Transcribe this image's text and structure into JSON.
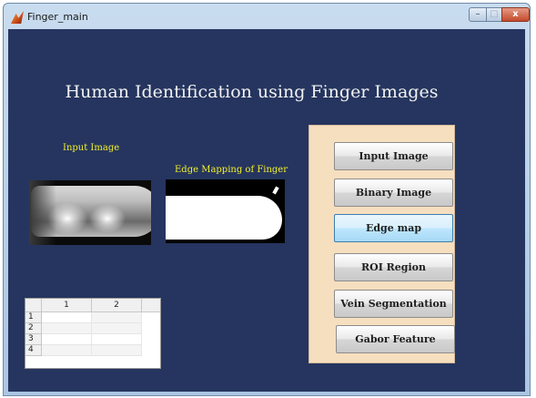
{
  "window": {
    "title": "Finger_main",
    "controls": {
      "minimize": "–",
      "maximize": "□",
      "close": "x"
    }
  },
  "main": {
    "heading": "Human Identification using Finger Images",
    "input_image_label": "Input Image",
    "edge_mapping_label": "Edge Mapping of Finger"
  },
  "table": {
    "columns": [
      "1",
      "2"
    ],
    "rows": [
      "1",
      "2",
      "3",
      "4"
    ]
  },
  "actions": [
    {
      "label": "Input Image",
      "active": false
    },
    {
      "label": "Binary Image",
      "active": false
    },
    {
      "label": "Edge map",
      "active": true
    },
    {
      "label": "ROI Region",
      "active": false
    },
    {
      "label": "Vein Segmentation",
      "active": false
    },
    {
      "label": "Gabor Feature",
      "active": false
    }
  ]
}
